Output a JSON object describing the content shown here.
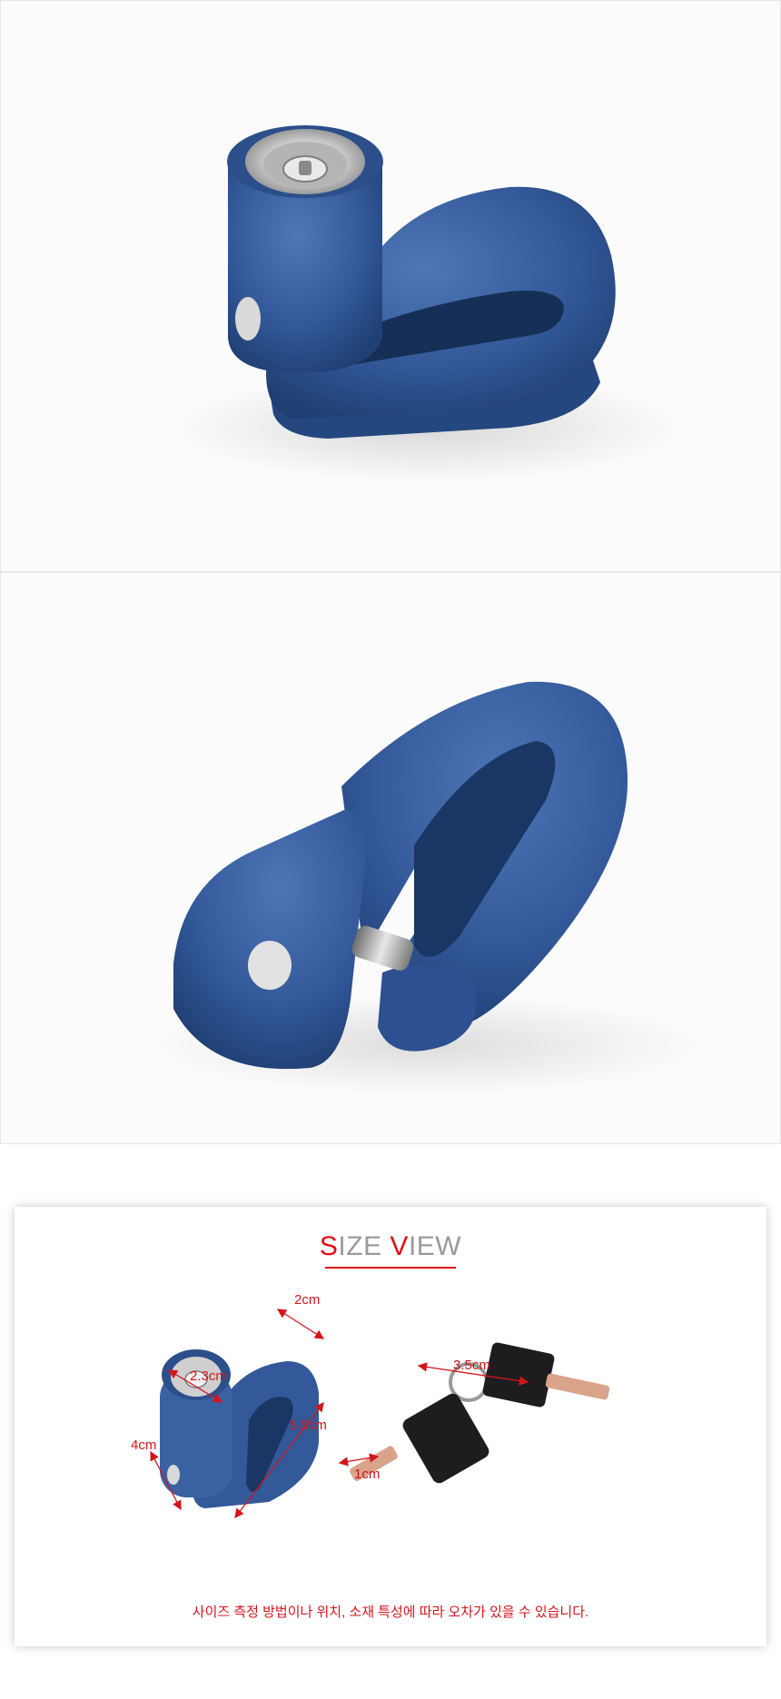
{
  "size_view": {
    "title_first_s": "S",
    "title_ize": "IZE ",
    "title_v": "V",
    "title_iew": "IEW",
    "dimensions": {
      "depth": "2cm",
      "cylinder": "2.3cm",
      "length": "5.5cm",
      "height": "4cm",
      "key_length": "3.5cm",
      "key_width": "1cm"
    },
    "notice": "사이즈 측정 방법이나 위치, 소재 특성에 따라 오차가 있을 수 있습니다."
  },
  "colors": {
    "accent": "#e10f14",
    "title_gray": "#9a9a9a",
    "lock_blue": "#2f5592"
  }
}
